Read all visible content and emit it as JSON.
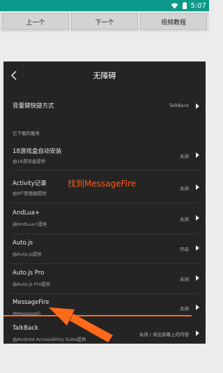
{
  "status_bar": {
    "time": "5:07"
  },
  "toolbar": {
    "prev_label": "上一个",
    "next_label": "下一个",
    "tutorial_label": "视频教程"
  },
  "screen": {
    "title": "无障碍",
    "volume_shortcut": {
      "label": "音量键快捷方式",
      "value": "TalkBack"
    },
    "section_label": "已下载的服务",
    "services": [
      {
        "name": "18游戏盒自动安装",
        "provider": "由18游戏盒提供",
        "status": "关闭"
      },
      {
        "name": "Activity记录",
        "provider": "由MT管理器提供",
        "status": "关闭"
      },
      {
        "name": "AndLua+",
        "provider": "由AndLua+提供",
        "status": "关闭"
      },
      {
        "name": "Auto.js",
        "provider": "由Auto.js提供",
        "status": "开启"
      },
      {
        "name": "Auto.js Pro",
        "provider": "由Auto.js Pro提供",
        "status": "关闭"
      },
      {
        "name": "MessageFire",
        "provider": "由MessageFi",
        "status": "关闭"
      },
      {
        "name": "TalkBack",
        "provider": "由Android Accessibility Suite提供",
        "status": "关闭 / 读出屏幕上的内容"
      }
    ]
  },
  "annotation": {
    "text": "找到MessageFire",
    "color": "#ff5a19"
  },
  "colors": {
    "status_bar": "#0c9a8a",
    "panel_bg": "#242424",
    "annotation": "#ff6a1a"
  }
}
